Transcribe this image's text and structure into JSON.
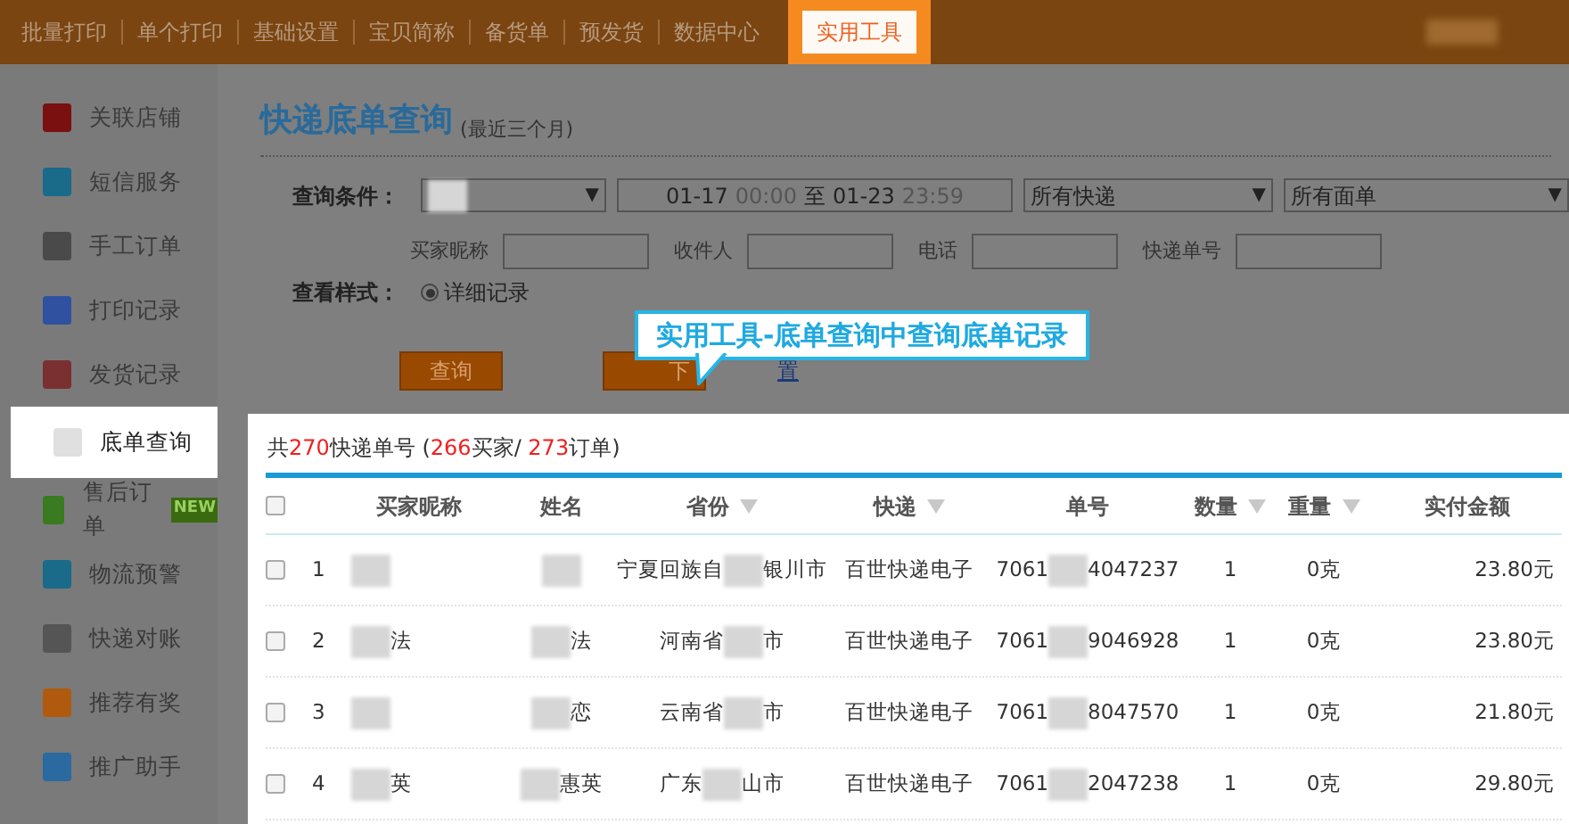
{
  "top_nav": [
    {
      "label": "批量打印",
      "selected": false
    },
    {
      "label": "单个打印",
      "selected": false
    },
    {
      "label": "基础设置",
      "selected": false
    },
    {
      "label": "宝贝简称",
      "selected": false
    },
    {
      "label": "备货单",
      "selected": false
    },
    {
      "label": "预发货",
      "selected": false
    },
    {
      "label": "数据中心",
      "selected": false
    },
    {
      "label": "实用工具",
      "selected": true
    }
  ],
  "sidebar": [
    {
      "label": "关联店铺",
      "selected": false
    },
    {
      "label": "短信服务",
      "selected": false
    },
    {
      "label": "手工订单",
      "selected": false
    },
    {
      "label": "打印记录",
      "selected": false
    },
    {
      "label": "发货记录",
      "selected": false
    },
    {
      "label": "底单查询",
      "selected": true
    },
    {
      "label": "售后订单",
      "selected": false,
      "badge": "NEW"
    },
    {
      "label": "物流预警",
      "selected": false
    },
    {
      "label": "快递对账",
      "selected": false
    },
    {
      "label": "推荐有奖",
      "selected": false
    },
    {
      "label": "推广助手",
      "selected": false
    }
  ],
  "page": {
    "title": "快递底单查询",
    "subtitle": "(最近三个月)"
  },
  "filters": {
    "label": "查询条件：",
    "caret": "▼",
    "date_from": "01-17",
    "time_from": "00:00",
    "to": "至",
    "date_to": "01-23",
    "time_to": "23:59",
    "express": "所有快递",
    "waybill": "所有面单",
    "fields": [
      {
        "label": "买家昵称"
      },
      {
        "label": "收件人"
      },
      {
        "label": "电话"
      },
      {
        "label": "快递单号"
      }
    ],
    "view_label": "查看样式：",
    "view_option": {
      "label": "详细记录",
      "selected": true
    }
  },
  "buttons": {
    "search": "查询",
    "download": "下",
    "reset": "置"
  },
  "callout": "实用工具-底单查询中查询底单记录",
  "summary": {
    "p1": "共",
    "count": "270",
    "p2": "快递单号 (",
    "buyers": "266",
    "p3": "买家/ ",
    "orders": "273",
    "p4": "订单)"
  },
  "table": {
    "select_all_checked": false,
    "columns": [
      {
        "label": "买家昵称",
        "sortable": false
      },
      {
        "label": "姓名",
        "sortable": false
      },
      {
        "label": "省份",
        "sortable": true
      },
      {
        "label": "快递",
        "sortable": true
      },
      {
        "label": "单号",
        "sortable": false
      },
      {
        "label": "数量",
        "sortable": true
      },
      {
        "label": "重量",
        "sortable": true
      },
      {
        "label": "实付金额",
        "sortable": false
      }
    ],
    "rows": [
      {
        "index": "1",
        "checked": false,
        "buyer": {},
        "name": {},
        "province": {
          "pre": "宁夏回族自",
          "post": "银川市"
        },
        "express": "百世快递电子",
        "number": {
          "pre": "7061",
          "post": "4047237"
        },
        "qty": "1",
        "weight": "0克",
        "amount": "23.80元"
      },
      {
        "index": "2",
        "checked": false,
        "buyer": {
          "post": "法"
        },
        "name": {
          "post": "法"
        },
        "province": {
          "pre": "河南省",
          "post": "市"
        },
        "express": "百世快递电子",
        "number": {
          "pre": "7061",
          "post": "9046928"
        },
        "qty": "1",
        "weight": "0克",
        "amount": "23.80元"
      },
      {
        "index": "3",
        "checked": false,
        "buyer": {},
        "name": {
          "post": "恋"
        },
        "province": {
          "pre": "云南省",
          "post": "市"
        },
        "express": "百世快递电子",
        "number": {
          "pre": "7061",
          "post": "8047570"
        },
        "qty": "1",
        "weight": "0克",
        "amount": "21.80元"
      },
      {
        "index": "4",
        "checked": false,
        "buyer": {
          "post": "英"
        },
        "name": {
          "post": "惠英"
        },
        "province": {
          "pre": "广东",
          "post": "山市"
        },
        "express": "百世快递电子",
        "number": {
          "pre": "7061",
          "post": "2047238"
        },
        "qty": "1",
        "weight": "0克",
        "amount": "29.80元"
      }
    ]
  }
}
